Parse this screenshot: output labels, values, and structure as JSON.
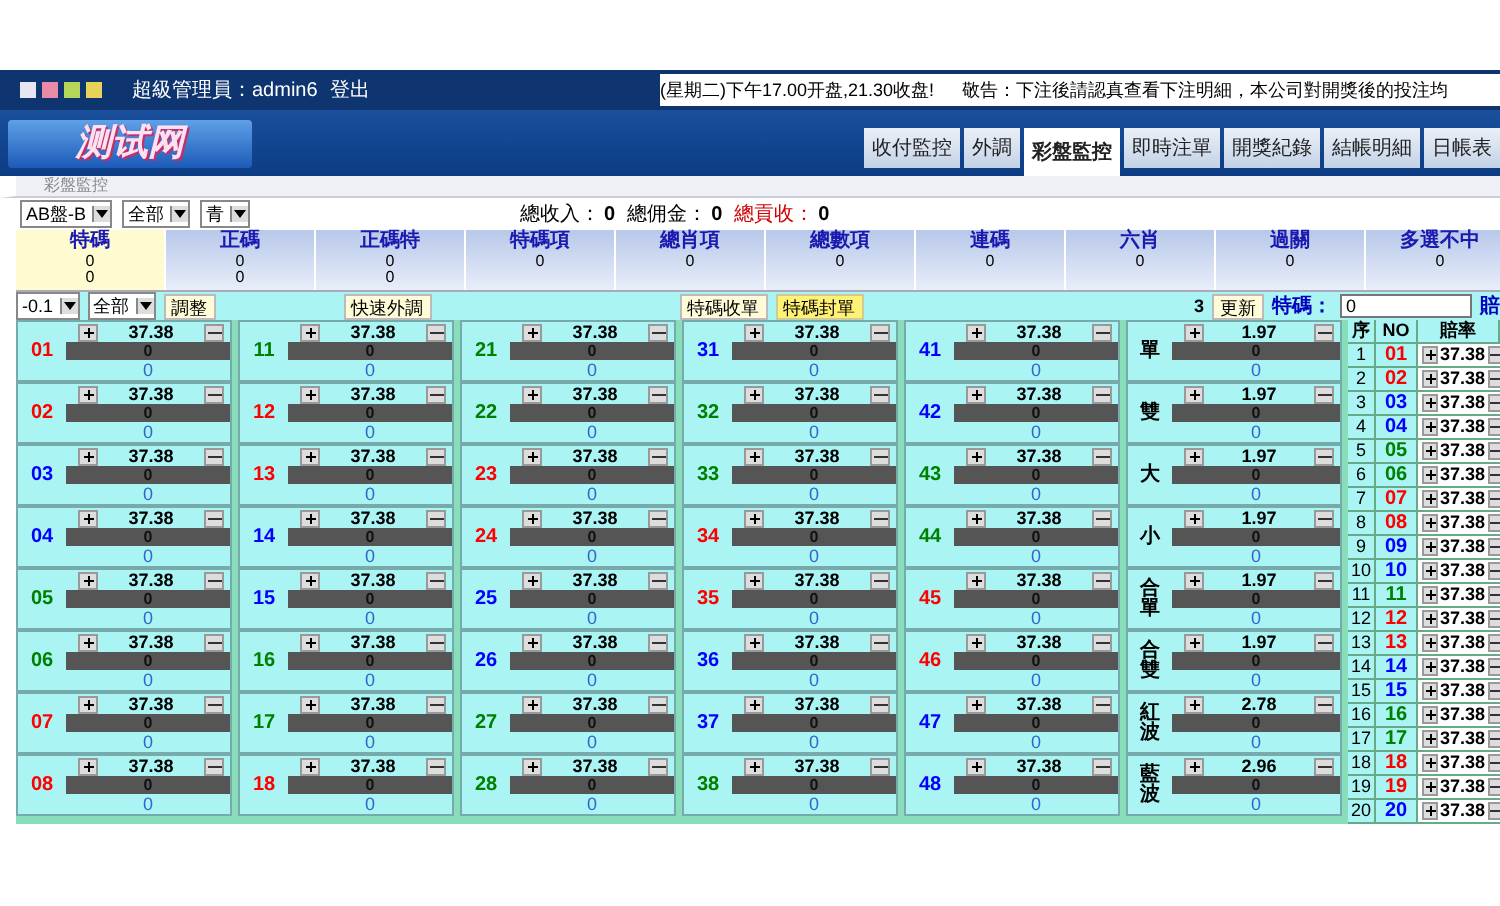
{
  "top_bar": {
    "user": "超級管理員：admin6",
    "logout": "登出",
    "notice": "(星期二)下午17.00开盘,21.30收盘!",
    "warning": "敬告：下注後請認真查看下注明細，本公司對開獎後的投注均"
  },
  "logo": "测试网",
  "tabs": [
    {
      "label": "收付監控",
      "selected": false
    },
    {
      "label": "外調",
      "selected": false
    },
    {
      "label": "彩盤監控",
      "selected": true
    },
    {
      "label": "即時注單",
      "selected": false
    },
    {
      "label": "開獎紀錄",
      "selected": false
    },
    {
      "label": "結帳明細",
      "selected": false
    },
    {
      "label": "日帳表",
      "selected": false
    }
  ],
  "breadcrumb": "彩盤監控",
  "filters": [
    "AB盤-B",
    "全部",
    "青"
  ],
  "totals": [
    {
      "label": "總收入：",
      "value": "0",
      "kind": "normal"
    },
    {
      "label": "總佣金：",
      "value": "0",
      "kind": "normal"
    },
    {
      "label": "總貢收：",
      "value": "0",
      "kind": "alert"
    }
  ],
  "categories": [
    {
      "label": "特碼",
      "values": [
        "0",
        "0"
      ],
      "selected": true
    },
    {
      "label": "正碼",
      "values": [
        "0",
        "0"
      ],
      "selected": false
    },
    {
      "label": "正碼特",
      "values": [
        "0",
        "0"
      ],
      "selected": false
    },
    {
      "label": "特碼項",
      "values": [
        "0"
      ],
      "selected": false
    },
    {
      "label": "總肖項",
      "values": [
        "0"
      ],
      "selected": false
    },
    {
      "label": "總數項",
      "values": [
        "0"
      ],
      "selected": false
    },
    {
      "label": "連碼",
      "values": [
        "0"
      ],
      "selected": false
    },
    {
      "label": "六肖",
      "values": [
        "0"
      ],
      "selected": false
    },
    {
      "label": "過關",
      "values": [
        "0"
      ],
      "selected": false
    },
    {
      "label": "多選不中",
      "values": [
        "0"
      ],
      "selected": false
    }
  ],
  "controls": {
    "adjust_select": "-0.1",
    "scope_select": "全部",
    "adjust_button": "調整",
    "quick_button": "快速外調",
    "collect_button": "特碼收單",
    "close_button": "特碼封單",
    "count": "3",
    "refresh_button": "更新",
    "special_label": "特碼：",
    "special_value": "0",
    "odds_label": "賠"
  },
  "number_columns": [
    [
      {
        "no": "01",
        "color": "#ff0000",
        "odds": "37.38",
        "amount": "0",
        "count": "0"
      },
      {
        "no": "02",
        "color": "#ff0000",
        "odds": "37.38",
        "amount": "0",
        "count": "0"
      },
      {
        "no": "03",
        "color": "#0000ff",
        "odds": "37.38",
        "amount": "0",
        "count": "0"
      },
      {
        "no": "04",
        "color": "#0000ff",
        "odds": "37.38",
        "amount": "0",
        "count": "0"
      },
      {
        "no": "05",
        "color": "#008000",
        "odds": "37.38",
        "amount": "0",
        "count": "0"
      },
      {
        "no": "06",
        "color": "#008000",
        "odds": "37.38",
        "amount": "0",
        "count": "0"
      },
      {
        "no": "07",
        "color": "#ff0000",
        "odds": "37.38",
        "amount": "0",
        "count": "0"
      },
      {
        "no": "08",
        "color": "#ff0000",
        "odds": "37.38",
        "amount": "0",
        "count": "0"
      }
    ],
    [
      {
        "no": "11",
        "color": "#008000",
        "odds": "37.38",
        "amount": "0",
        "count": "0"
      },
      {
        "no": "12",
        "color": "#ff0000",
        "odds": "37.38",
        "amount": "0",
        "count": "0"
      },
      {
        "no": "13",
        "color": "#ff0000",
        "odds": "37.38",
        "amount": "0",
        "count": "0"
      },
      {
        "no": "14",
        "color": "#0000ff",
        "odds": "37.38",
        "amount": "0",
        "count": "0"
      },
      {
        "no": "15",
        "color": "#0000ff",
        "odds": "37.38",
        "amount": "0",
        "count": "0"
      },
      {
        "no": "16",
        "color": "#008000",
        "odds": "37.38",
        "amount": "0",
        "count": "0"
      },
      {
        "no": "17",
        "color": "#008000",
        "odds": "37.38",
        "amount": "0",
        "count": "0"
      },
      {
        "no": "18",
        "color": "#ff0000",
        "odds": "37.38",
        "amount": "0",
        "count": "0"
      }
    ],
    [
      {
        "no": "21",
        "color": "#008000",
        "odds": "37.38",
        "amount": "0",
        "count": "0"
      },
      {
        "no": "22",
        "color": "#008000",
        "odds": "37.38",
        "amount": "0",
        "count": "0"
      },
      {
        "no": "23",
        "color": "#ff0000",
        "odds": "37.38",
        "amount": "0",
        "count": "0"
      },
      {
        "no": "24",
        "color": "#ff0000",
        "odds": "37.38",
        "amount": "0",
        "count": "0"
      },
      {
        "no": "25",
        "color": "#0000ff",
        "odds": "37.38",
        "amount": "0",
        "count": "0"
      },
      {
        "no": "26",
        "color": "#0000ff",
        "odds": "37.38",
        "amount": "0",
        "count": "0"
      },
      {
        "no": "27",
        "color": "#008000",
        "odds": "37.38",
        "amount": "0",
        "count": "0"
      },
      {
        "no": "28",
        "color": "#008000",
        "odds": "37.38",
        "amount": "0",
        "count": "0"
      }
    ],
    [
      {
        "no": "31",
        "color": "#0000ff",
        "odds": "37.38",
        "amount": "0",
        "count": "0"
      },
      {
        "no": "32",
        "color": "#008000",
        "odds": "37.38",
        "amount": "0",
        "count": "0"
      },
      {
        "no": "33",
        "color": "#008000",
        "odds": "37.38",
        "amount": "0",
        "count": "0"
      },
      {
        "no": "34",
        "color": "#ff0000",
        "odds": "37.38",
        "amount": "0",
        "count": "0"
      },
      {
        "no": "35",
        "color": "#ff0000",
        "odds": "37.38",
        "amount": "0",
        "count": "0"
      },
      {
        "no": "36",
        "color": "#0000ff",
        "odds": "37.38",
        "amount": "0",
        "count": "0"
      },
      {
        "no": "37",
        "color": "#0000ff",
        "odds": "37.38",
        "amount": "0",
        "count": "0"
      },
      {
        "no": "38",
        "color": "#008000",
        "odds": "37.38",
        "amount": "0",
        "count": "0"
      }
    ],
    [
      {
        "no": "41",
        "color": "#0000ff",
        "odds": "37.38",
        "amount": "0",
        "count": "0"
      },
      {
        "no": "42",
        "color": "#0000ff",
        "odds": "37.38",
        "amount": "0",
        "count": "0"
      },
      {
        "no": "43",
        "color": "#008000",
        "odds": "37.38",
        "amount": "0",
        "count": "0"
      },
      {
        "no": "44",
        "color": "#008000",
        "odds": "37.38",
        "amount": "0",
        "count": "0"
      },
      {
        "no": "45",
        "color": "#ff0000",
        "odds": "37.38",
        "amount": "0",
        "count": "0"
      },
      {
        "no": "46",
        "color": "#ff0000",
        "odds": "37.38",
        "amount": "0",
        "count": "0"
      },
      {
        "no": "47",
        "color": "#0000ff",
        "odds": "37.38",
        "amount": "0",
        "count": "0"
      },
      {
        "no": "48",
        "color": "#0000ff",
        "odds": "37.38",
        "amount": "0",
        "count": "0"
      }
    ]
  ],
  "special_column": [
    {
      "label": "單",
      "odds": "1.97",
      "amount": "0",
      "count": "0"
    },
    {
      "label": "雙",
      "odds": "1.97",
      "amount": "0",
      "count": "0"
    },
    {
      "label": "大",
      "odds": "1.97",
      "amount": "0",
      "count": "0"
    },
    {
      "label": "小",
      "odds": "1.97",
      "amount": "0",
      "count": "0"
    },
    {
      "label": "合單",
      "odds": "1.97",
      "amount": "0",
      "count": "0"
    },
    {
      "label": "合雙",
      "odds": "1.97",
      "amount": "0",
      "count": "0"
    },
    {
      "label": "紅波",
      "odds": "2.78",
      "amount": "0",
      "count": "0"
    },
    {
      "label": "藍波",
      "odds": "2.96",
      "amount": "0",
      "count": "0"
    }
  ],
  "odds_table": {
    "columns": [
      "序",
      "NO",
      "賠率"
    ],
    "rows": [
      {
        "seq": "1",
        "no": "01",
        "color": "#ff0000",
        "odds": "37.38"
      },
      {
        "seq": "2",
        "no": "02",
        "color": "#ff0000",
        "odds": "37.38"
      },
      {
        "seq": "3",
        "no": "03",
        "color": "#0000ff",
        "odds": "37.38"
      },
      {
        "seq": "4",
        "no": "04",
        "color": "#0000ff",
        "odds": "37.38"
      },
      {
        "seq": "5",
        "no": "05",
        "color": "#008000",
        "odds": "37.38"
      },
      {
        "seq": "6",
        "no": "06",
        "color": "#008000",
        "odds": "37.38"
      },
      {
        "seq": "7",
        "no": "07",
        "color": "#ff0000",
        "odds": "37.38"
      },
      {
        "seq": "8",
        "no": "08",
        "color": "#ff0000",
        "odds": "37.38"
      },
      {
        "seq": "9",
        "no": "09",
        "color": "#0000ff",
        "odds": "37.38"
      },
      {
        "seq": "10",
        "no": "10",
        "color": "#0000ff",
        "odds": "37.38"
      },
      {
        "seq": "11",
        "no": "11",
        "color": "#008000",
        "odds": "37.38"
      },
      {
        "seq": "12",
        "no": "12",
        "color": "#ff0000",
        "odds": "37.38"
      },
      {
        "seq": "13",
        "no": "13",
        "color": "#ff0000",
        "odds": "37.38"
      },
      {
        "seq": "14",
        "no": "14",
        "color": "#0000ff",
        "odds": "37.38"
      },
      {
        "seq": "15",
        "no": "15",
        "color": "#0000ff",
        "odds": "37.38"
      },
      {
        "seq": "16",
        "no": "16",
        "color": "#008000",
        "odds": "37.38"
      },
      {
        "seq": "17",
        "no": "17",
        "color": "#008000",
        "odds": "37.38"
      },
      {
        "seq": "18",
        "no": "18",
        "color": "#ff0000",
        "odds": "37.38"
      },
      {
        "seq": "19",
        "no": "19",
        "color": "#ff0000",
        "odds": "37.38"
      },
      {
        "seq": "20",
        "no": "20",
        "color": "#0000ff",
        "odds": "37.38"
      }
    ]
  }
}
